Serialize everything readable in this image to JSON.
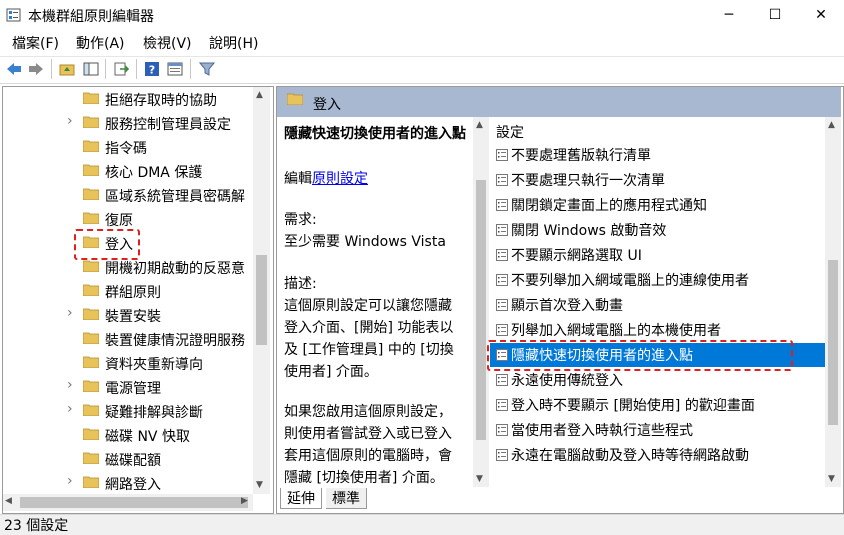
{
  "window": {
    "title": "本機群組原則編輯器",
    "minimize": "─",
    "maximize": "☐",
    "close": "✕"
  },
  "menu": [
    "檔案(F)",
    "動作(A)",
    "檢視(V)",
    "說明(H)"
  ],
  "toolbar": [
    "back-icon",
    "forward-icon",
    "up-folder-icon",
    "show-hide-tree-icon",
    "export-list-icon",
    "help-icon",
    "properties-icon",
    "filter-icon"
  ],
  "tree": {
    "items": [
      {
        "label": "拒絕存取時的協助",
        "expandable": false
      },
      {
        "label": "服務控制管理員設定",
        "expandable": true
      },
      {
        "label": "指令碼",
        "expandable": false
      },
      {
        "label": "核心 DMA 保護",
        "expandable": false
      },
      {
        "label": "區域系統管理員密碼解",
        "expandable": false
      },
      {
        "label": "復原",
        "expandable": false
      },
      {
        "label": "登入",
        "expandable": false,
        "selected": true
      },
      {
        "label": "開機初期啟動的反惡意",
        "expandable": false
      },
      {
        "label": "群組原則",
        "expandable": false
      },
      {
        "label": "裝置安裝",
        "expandable": true
      },
      {
        "label": "裝置健康情況證明服務",
        "expandable": false
      },
      {
        "label": "資料夾重新導向",
        "expandable": false
      },
      {
        "label": "電源管理",
        "expandable": true
      },
      {
        "label": "疑難排解與診斷",
        "expandable": true
      },
      {
        "label": "磁碟 NV 快取",
        "expandable": false
      },
      {
        "label": "磁碟配額",
        "expandable": false
      },
      {
        "label": "網路登入",
        "expandable": true
      }
    ]
  },
  "right_header": {
    "title": "登入"
  },
  "description": {
    "title": "隱藏快速切換使用者的進入點",
    "edit_prefix": "編輯",
    "edit_link": "原則設定",
    "req_label": "需求:",
    "req_value": "至少需要 Windows Vista",
    "desc_label": "描述:",
    "desc_lines": [
      "這個原則設定可以讓您隱藏",
      "登入介面、[開始] 功能表以",
      "及 [工作管理員] 中的 [切換",
      "使用者] 介面。"
    ],
    "desc_lines2": [
      "如果您啟用這個原則設定，",
      "則使用者嘗試登入或已登入",
      "套用這個原則的電腦時，會",
      "隱藏 [切換使用者] 介面。"
    ]
  },
  "settings": {
    "header": "設定",
    "items": [
      {
        "label": "不要處理舊版執行清單"
      },
      {
        "label": "不要處理只執行一次清單"
      },
      {
        "label": "關閉鎖定畫面上的應用程式通知"
      },
      {
        "label": "關閉 Windows 啟動音效"
      },
      {
        "label": "不要顯示網路選取 UI"
      },
      {
        "label": "不要列舉加入網域電腦上的連線使用者"
      },
      {
        "label": "顯示首次登入動畫"
      },
      {
        "label": "列舉加入網域電腦上的本機使用者"
      },
      {
        "label": "隱藏快速切換使用者的進入點",
        "selected": true
      },
      {
        "label": "永遠使用傳統登入"
      },
      {
        "label": "登入時不要顯示 [開始使用] 的歡迎畫面"
      },
      {
        "label": "當使用者登入時執行這些程式"
      },
      {
        "label": "永遠在電腦啟動及登入時等待網路啟動"
      }
    ]
  },
  "tabs": [
    "延伸",
    "標準"
  ],
  "status": {
    "text": "23 個設定"
  },
  "colors": {
    "selection": "#0078d7",
    "header": "#a8b8d0",
    "highlight_box": "#e0201c",
    "folder": "#e8c25a"
  }
}
